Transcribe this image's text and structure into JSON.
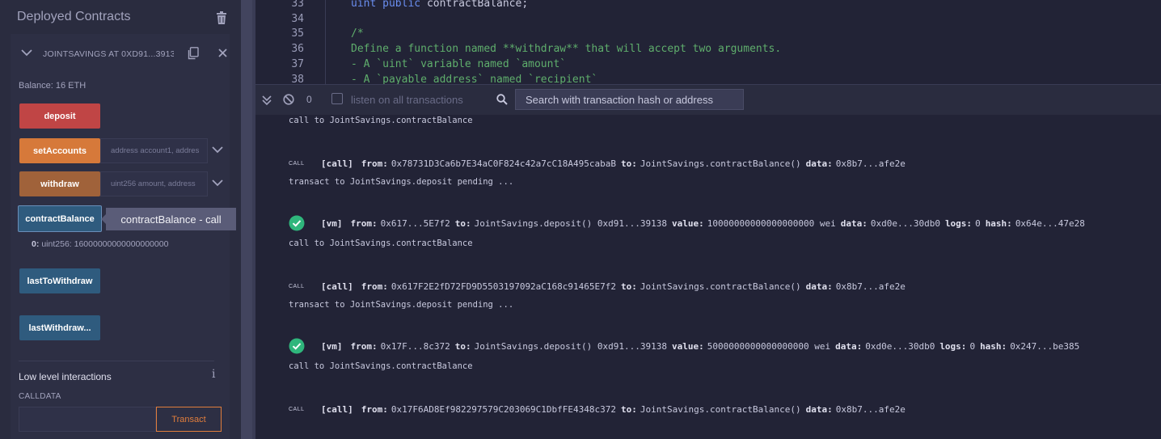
{
  "left_panel": {
    "title": "Deployed Contracts",
    "contract": {
      "name": "JOINTSAVINGS AT 0XD91...3913",
      "balance": "Balance: 16 ETH"
    },
    "functions": [
      {
        "label": "deposit",
        "color": "#c04545"
      },
      {
        "label": "setAccounts",
        "color": "#d6793a",
        "placeholder": "address account1, addres"
      },
      {
        "label": "withdraw",
        "color": "#a0623a",
        "placeholder": "uint256 amount, address"
      },
      {
        "label": "contractBalance",
        "color": "#2f5b7e"
      },
      {
        "label": "lastToWithdraw",
        "color": "#2f5b7e"
      },
      {
        "label": "lastWithdraw...",
        "color": "#2f5b7e"
      }
    ],
    "tooltip": "contractBalance - call",
    "result": {
      "index": "0:",
      "value": "uint256: 16000000000000000000"
    },
    "low_level": {
      "title": "Low level interactions",
      "calldata_label": "CALLDATA",
      "transact_label": "Transact"
    }
  },
  "editor": {
    "lines": [
      {
        "num": "33",
        "parts": [
          {
            "t": "uint ",
            "c": "kw"
          },
          {
            "t": "public ",
            "c": "kw"
          },
          {
            "t": "contractBalance;",
            "c": "plain"
          }
        ]
      },
      {
        "num": "34",
        "parts": []
      },
      {
        "num": "35",
        "parts": [
          {
            "t": "/*",
            "c": "cm"
          }
        ]
      },
      {
        "num": "36",
        "parts": [
          {
            "t": "Define a function named **withdraw** that will accept two arguments.",
            "c": "cm"
          }
        ]
      },
      {
        "num": "37",
        "parts": [
          {
            "t": "- A `uint` variable named `amount`",
            "c": "cm"
          }
        ]
      },
      {
        "num": "38",
        "parts": [
          {
            "t": "- A `payable address` named `recipient`",
            "c": "cm"
          }
        ]
      }
    ]
  },
  "terminal_bar": {
    "count": "0",
    "listen_label": "listen on all transactions",
    "search_placeholder": "Search with transaction hash or address"
  },
  "terminal": {
    "call_badge": "CALL",
    "entries": [
      {
        "type": "text",
        "text": "call to JointSavings.contractBalance"
      },
      {
        "type": "call",
        "items": [
          [
            "[call]",
            ""
          ],
          [
            "from:",
            "0x78731D3Ca6b7E34aC0F824c42a7cC18A495cabaB"
          ],
          [
            "to:",
            "JointSavings.contractBalance()"
          ],
          [
            "data:",
            "0x8b7...afe2e"
          ]
        ]
      },
      {
        "type": "text",
        "text": "transact to JointSavings.deposit pending ..."
      },
      {
        "type": "vm",
        "items": [
          [
            "[vm]",
            ""
          ],
          [
            "from:",
            "0x617...5E7f2"
          ],
          [
            "to:",
            "JointSavings.deposit() 0xd91...39138"
          ],
          [
            "value:",
            "10000000000000000000 wei"
          ],
          [
            "data:",
            "0xd0e...30db0"
          ],
          [
            "logs:",
            "0"
          ],
          [
            "hash:",
            "0x64e...47e28"
          ]
        ]
      },
      {
        "type": "text",
        "text": "call to JointSavings.contractBalance"
      },
      {
        "type": "call",
        "items": [
          [
            "[call]",
            ""
          ],
          [
            "from:",
            "0x617F2E2fD72FD9D5503197092aC168c91465E7f2"
          ],
          [
            "to:",
            "JointSavings.contractBalance()"
          ],
          [
            "data:",
            "0x8b7...afe2e"
          ]
        ]
      },
      {
        "type": "text",
        "text": "transact to JointSavings.deposit pending ..."
      },
      {
        "type": "vm",
        "items": [
          [
            "[vm]",
            ""
          ],
          [
            "from:",
            "0x17F...8c372"
          ],
          [
            "to:",
            "JointSavings.deposit() 0xd91...39138"
          ],
          [
            "value:",
            "5000000000000000000 wei"
          ],
          [
            "data:",
            "0xd0e...30db0"
          ],
          [
            "logs:",
            "0"
          ],
          [
            "hash:",
            "0x247...be385"
          ]
        ]
      },
      {
        "type": "text",
        "text": "call to JointSavings.contractBalance"
      },
      {
        "type": "call",
        "items": [
          [
            "[call]",
            ""
          ],
          [
            "from:",
            "0x17F6AD8Ef982297579C203069C1DbfFE4348c372"
          ],
          [
            "to:",
            "JointSavings.contractBalance()"
          ],
          [
            "data:",
            "0x8b7...afe2e"
          ]
        ]
      }
    ]
  }
}
